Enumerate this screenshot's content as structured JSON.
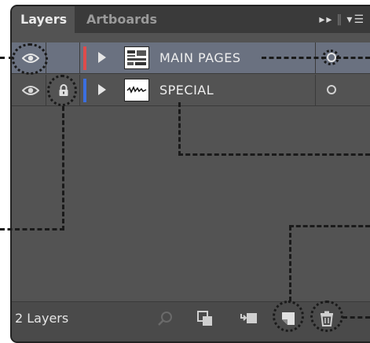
{
  "panel": {
    "tabs": [
      {
        "label": "Layers",
        "active": true
      },
      {
        "label": "Artboards",
        "active": false
      }
    ],
    "menu_icons": [
      "fast-forward-icon",
      "panel-menu-icon"
    ]
  },
  "layers": [
    {
      "name": "MAIN PAGES",
      "visible": true,
      "locked": false,
      "color": "#e04b4b",
      "selected": true,
      "thumbnail_icon": "page-thumbnail-icon"
    },
    {
      "name": "SPECIAL",
      "visible": true,
      "locked": true,
      "color": "#3b6fe0",
      "selected": false,
      "thumbnail_icon": "signature-thumbnail-icon"
    }
  ],
  "footer": {
    "layer_count_label": "2 Layers",
    "buttons": [
      "locate-object-icon",
      "make-clipping-mask-icon",
      "create-sublayer-icon",
      "create-new-layer-icon",
      "delete-layer-icon"
    ]
  },
  "colors": {
    "panel_bg": "#535353",
    "selected_row_bg": "#6a7180",
    "tab_bar_bg": "#3a3a3a",
    "callout_line": "#1a1a1a"
  }
}
